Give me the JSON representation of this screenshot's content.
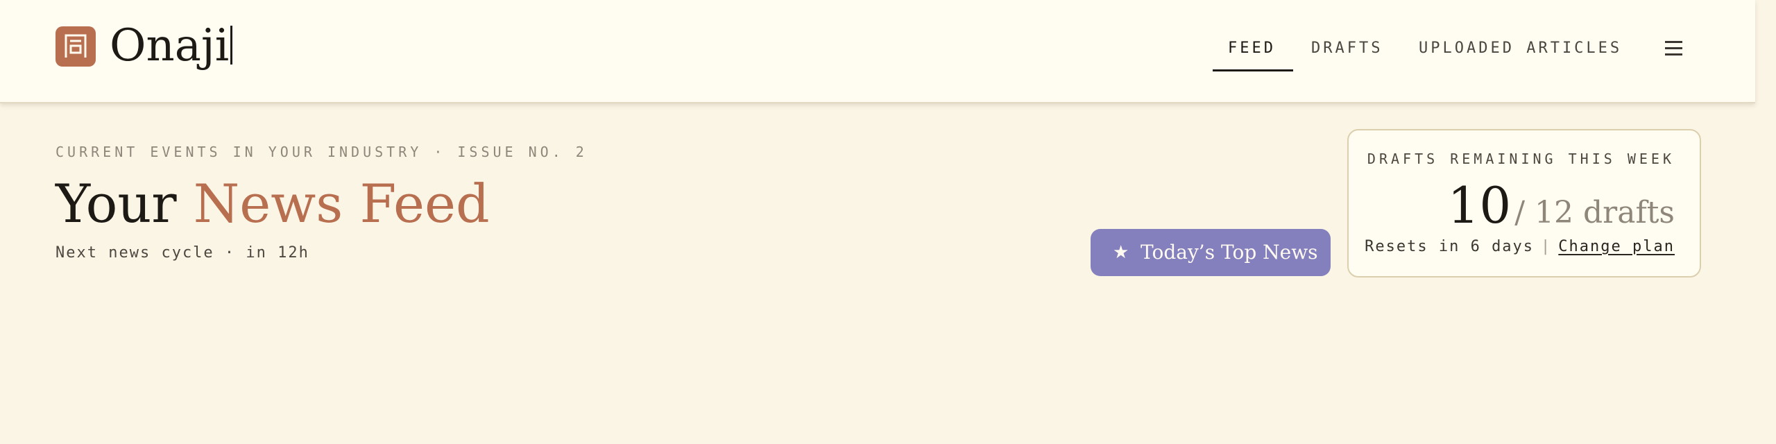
{
  "brand": {
    "name": "Onaji",
    "logo_icon": "kanji-onaji-logo-icon",
    "accent_color": "#b86f50"
  },
  "nav": {
    "tabs": [
      {
        "label": "FEED",
        "active": true
      },
      {
        "label": "DRAFTS",
        "active": false
      },
      {
        "label": "UPLOADED ARTICLES",
        "active": false
      }
    ],
    "menu_icon": "hamburger-menu-icon"
  },
  "header": {
    "kicker": "CURRENT EVENTS IN YOUR INDUSTRY · ISSUE NO. 2",
    "title_plain": "Your ",
    "title_accent": "News Feed",
    "subline": "Next news cycle · in 12h"
  },
  "top_news_button": {
    "icon": "star-icon",
    "label": "Today’s Top News",
    "color": "#8480bd"
  },
  "quota": {
    "title": "DRAFTS REMAINING THIS WEEK",
    "remaining": "10",
    "total_text": "/ 12 drafts",
    "reset_text": "Resets in 6 days",
    "separator": "|",
    "change_plan_label": "Change plan"
  }
}
